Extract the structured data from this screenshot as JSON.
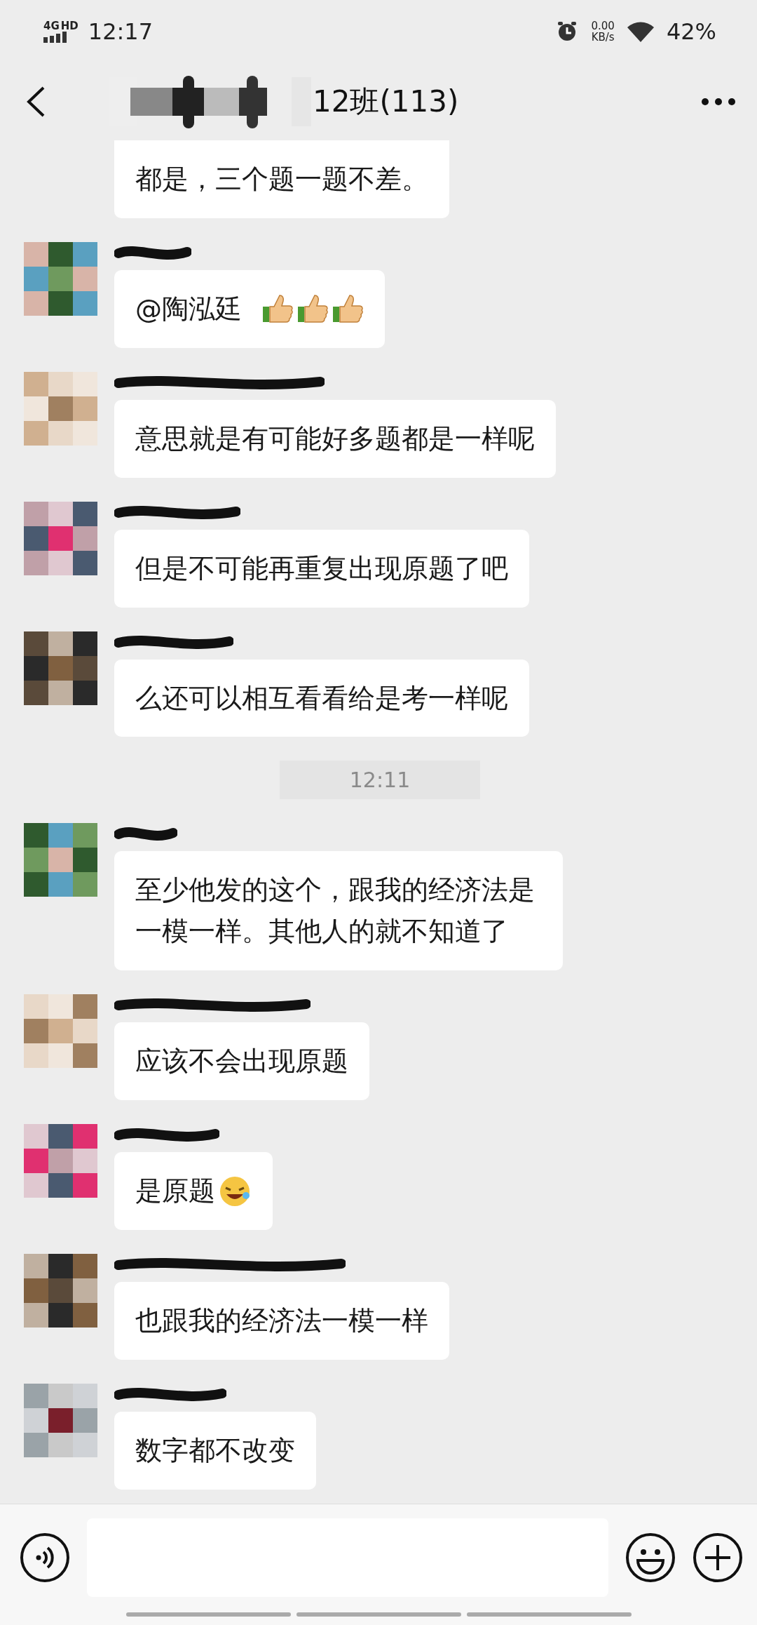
{
  "status_bar": {
    "network": "4G",
    "network_badge": "HD",
    "time": "12:17",
    "speed_value": "0.00",
    "speed_unit": "KB/s",
    "battery": "42%"
  },
  "header": {
    "title": "12班(113)"
  },
  "messages": [
    {
      "kind": "continued",
      "text": "都是，三个题一题不差。"
    },
    {
      "kind": "thumbs",
      "text": "@陶泓廷"
    },
    {
      "kind": "text",
      "text": "意思就是有可能好多题都是一样呢"
    },
    {
      "kind": "text",
      "text": "但是不可能再重复出现原题了吧"
    },
    {
      "kind": "text",
      "text": "么还可以相互看看给是考一样呢"
    },
    {
      "kind": "time",
      "text": "12:11"
    },
    {
      "kind": "text",
      "text": "至少他发的这个，跟我的经济法是一模一样。其他人的就不知道了"
    },
    {
      "kind": "text",
      "text": "应该不会出现原题"
    },
    {
      "kind": "laugh",
      "text": "是原题"
    },
    {
      "kind": "text",
      "text": "也跟我的经济法一模一样"
    },
    {
      "kind": "text",
      "text": "数字都不改变"
    }
  ]
}
